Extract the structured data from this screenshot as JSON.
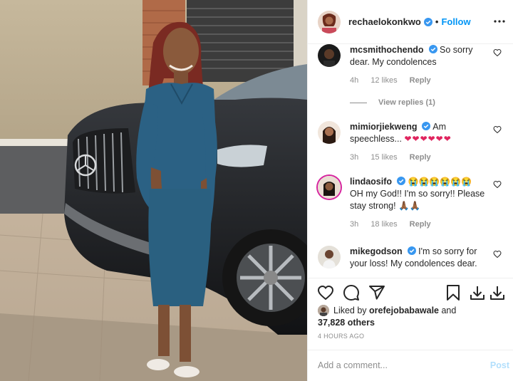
{
  "post": {
    "author": "rechaelokonkwo",
    "follow_label": "Follow",
    "dot": "•"
  },
  "comments": [
    {
      "user": "mcsmithochendo",
      "text": "So sorry dear. My condolences",
      "time": "4h",
      "likes": "12 likes",
      "reply": "Reply",
      "verified": true
    },
    {
      "user": "mimiorjiekweng",
      "text": "Am speechless...",
      "emoji": "❤❤❤❤❤❤",
      "time": "3h",
      "likes": "15 likes",
      "reply": "Reply",
      "verified": true
    },
    {
      "user": "lindaosifo",
      "emoji": "😭😭😭😭😭😭",
      "text": "OH my God!! I'm so sorry!! Please stay strong! 🙏🏾🙏🏾",
      "time": "3h",
      "likes": "18 likes",
      "reply": "Reply",
      "verified": true
    },
    {
      "user": "mikegodson",
      "text": "I'm so sorry for your loss! My condolences dear.",
      "verified": true
    }
  ],
  "view_replies": "View replies (1)",
  "likes": {
    "prefix": "Liked by",
    "user": "orefejobabawale",
    "and": "and",
    "others": "37,828 others"
  },
  "timestamp": "4 HOURS AGO",
  "add_comment": {
    "placeholder": "Add a comment...",
    "post_label": "Post"
  },
  "icons": [
    "heart-icon",
    "comment-icon",
    "share-icon",
    "bookmark-icon",
    "download-icon",
    "more-icon",
    "verified-icon"
  ],
  "colors": {
    "link": "#0095f6",
    "muted": "#8e8e8e",
    "heart": "#e0245e",
    "post_disabled": "#b2dffc"
  }
}
